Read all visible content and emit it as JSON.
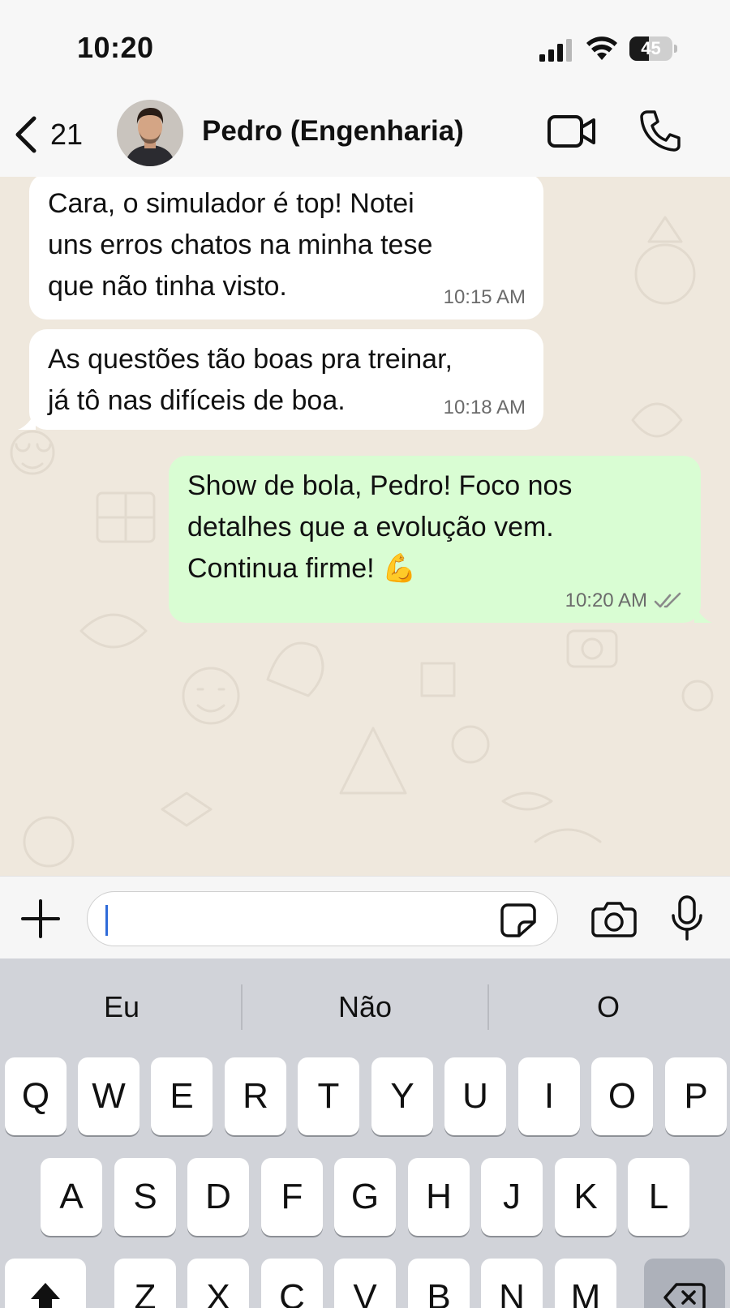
{
  "status_bar": {
    "time": "10:20",
    "battery_level": 45,
    "battery_text": "45"
  },
  "header": {
    "back_count": "21",
    "contact_name": "Pedro (Engenharia)"
  },
  "messages": [
    {
      "direction": "incoming",
      "text": "Cara, o simulador é top! Notei\nuns erros chatos na minha tese\nque não tinha visto.",
      "time": "10:15 AM"
    },
    {
      "direction": "incoming",
      "text": "As questões tão boas pra treinar,\njá tô nas difíceis de boa.",
      "time": "10:18 AM"
    },
    {
      "direction": "outgoing",
      "text": "Show de bola,  Pedro! Foco nos\ndetalhes que a evolução vem.\nContinua firme! 💪",
      "time": "10:20 AM",
      "status": "read"
    }
  ],
  "input": {
    "value": "",
    "placeholder": ""
  },
  "keyboard": {
    "suggestions": [
      "Eu",
      "Não",
      "O"
    ],
    "row1": [
      "Q",
      "W",
      "E",
      "R",
      "T",
      "Y",
      "U",
      "I",
      "O",
      "P"
    ],
    "row2": [
      "A",
      "S",
      "D",
      "F",
      "G",
      "H",
      "J",
      "K",
      "L"
    ],
    "row3": [
      "Z",
      "X",
      "C",
      "V",
      "B",
      "N",
      "M"
    ]
  },
  "colors": {
    "outgoing_bubble": "#d9fdd3",
    "incoming_bubble": "#ffffff",
    "chat_background": "#efe8dd",
    "ticks": "#8a8a8a"
  },
  "icons": [
    "chevron-left-icon",
    "video-icon",
    "phone-icon",
    "plus-icon",
    "sticker-icon",
    "camera-icon",
    "microphone-icon",
    "double-check-icon",
    "shift-icon",
    "backspace-icon"
  ]
}
